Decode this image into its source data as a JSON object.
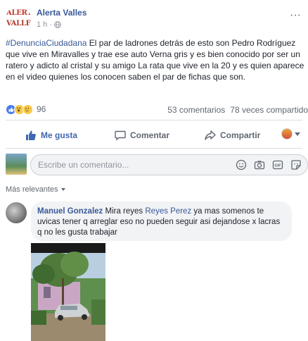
{
  "post": {
    "page_name": "Alerta Valles",
    "logo_line1": "ALERTA",
    "logo_line2": "VALLES",
    "time": "1 h ·",
    "hashtag": "#DenunciaCiudadana",
    "body": " El par de ladrones detrás de esto son Pedro Rodríguez que vive en Miravalles y trae ese auto Verna gris y es bien conocido por ser un ratero y adicto al cristal y su amigo La rata que vive en la 20 y es quien aparece en el video quienes los conocen saben el par de fichas que son."
  },
  "stats": {
    "reaction_count": "96",
    "comments": "53 comentarios",
    "shares": "78 veces compartido"
  },
  "actions": {
    "like": "Me gusta",
    "comment": "Comentar",
    "share": "Compartir"
  },
  "composer": {
    "placeholder": "Escribe un comentario..."
  },
  "sort_label": "Más relevantes",
  "comment": {
    "author": "Manuel Gonzalez",
    "text_before": " Mira reyes ",
    "mention": "Reyes Perez",
    "text_after": " ya mas somenos te uvicas tener q arreglar eso no pueden seguir asi dejandose x lacras q no les gusta trabajar"
  },
  "icons": [
    "globe-icon",
    "more-icon",
    "like-icon",
    "comment-icon",
    "share-icon",
    "emoji-icon",
    "camera-icon",
    "gif-icon",
    "sticker-icon",
    "caret-down-icon"
  ],
  "colors": {
    "link": "#385898",
    "like_active": "#4267b2",
    "muted": "#606770"
  }
}
